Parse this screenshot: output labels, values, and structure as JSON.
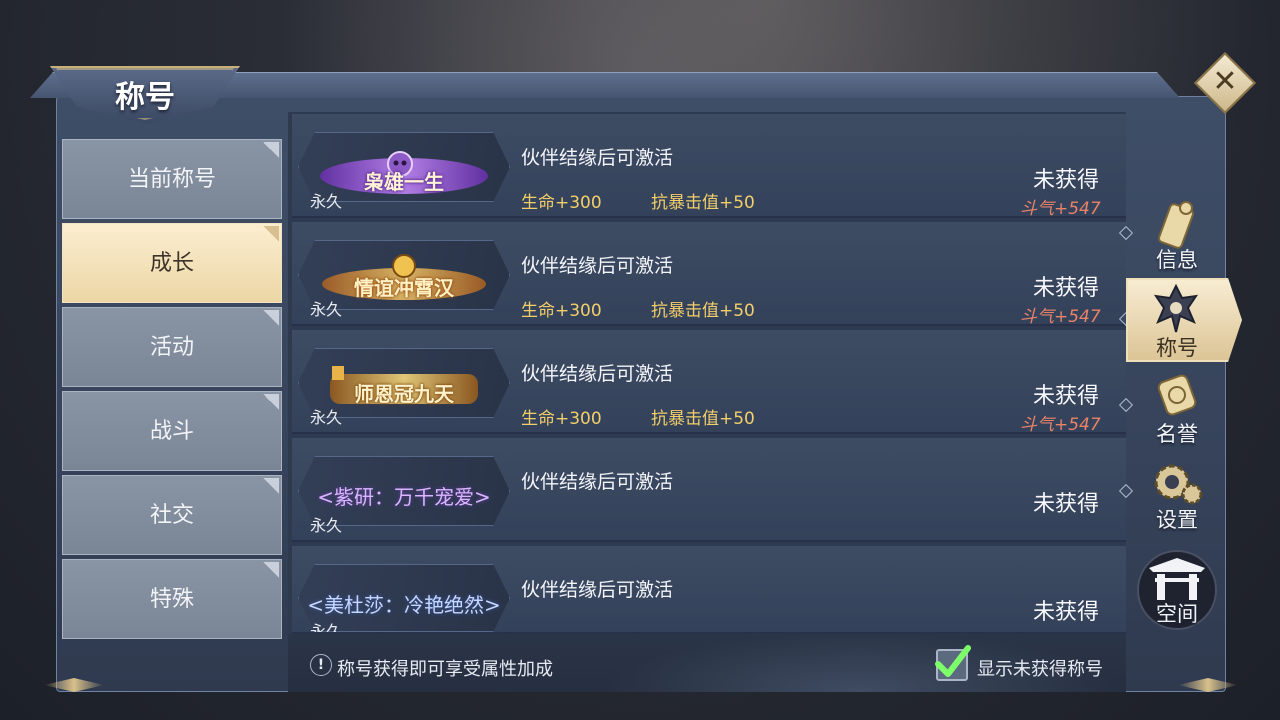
{
  "window": {
    "title": "称号",
    "close_icon": "close-x-icon"
  },
  "categories": [
    {
      "label": "当前称号",
      "active": false
    },
    {
      "label": "成长",
      "active": true
    },
    {
      "label": "活动",
      "active": false
    },
    {
      "label": "战斗",
      "active": false
    },
    {
      "label": "社交",
      "active": false
    },
    {
      "label": "特殊",
      "active": false
    }
  ],
  "titles": [
    {
      "badge_type": "art-purple-skull",
      "badge_art_text": "枭雄一生",
      "duration": "永久",
      "requirement": "伙伴结缘后可激活",
      "attr1": "生命+300",
      "attr2": "抗暴击值+50",
      "status": "未获得",
      "power": "斗气+547"
    },
    {
      "badge_type": "art-gold-flame",
      "badge_art_text": "情谊冲霄汉",
      "duration": "永久",
      "requirement": "伙伴结缘后可激活",
      "attr1": "生命+300",
      "attr2": "抗暴击值+50",
      "status": "未获得",
      "power": "斗气+547"
    },
    {
      "badge_type": "art-gold-scroll",
      "badge_art_text": "师恩冠九天",
      "duration": "永久",
      "requirement": "伙伴结缘后可激活",
      "attr1": "生命+300",
      "attr2": "抗暴击值+50",
      "status": "未获得",
      "power": "斗气+547"
    },
    {
      "badge_type": "text-purple",
      "badge_text": "<紫研：万千宠爱>",
      "duration": "永久",
      "requirement": "伙伴结缘后可激活",
      "status": "未获得"
    },
    {
      "badge_type": "text-blue",
      "badge_text": "<美杜莎：冷艳绝然>",
      "duration": "永久",
      "requirement": "伙伴结缘后可激活",
      "status": "未获得"
    }
  ],
  "footer": {
    "info_icon": "!",
    "tip": "称号获得即可享受属性加成",
    "checkbox_label": "显示未获得称号",
    "checkbox_checked": true
  },
  "side_tabs": [
    {
      "label": "信息",
      "icon": "scroll-icon",
      "active": false
    },
    {
      "label": "称号",
      "icon": "crest-icon",
      "active": true
    },
    {
      "label": "名誉",
      "icon": "medal-icon",
      "active": false
    },
    {
      "label": "设置",
      "icon": "gear-icon",
      "active": false
    },
    {
      "label": "空间",
      "icon": "gate-icon",
      "active": false
    }
  ],
  "colors": {
    "accent_gold": "#f2cf6a",
    "power_red": "#e88468",
    "active_tab": "#f7ecd2",
    "panel_blue": "#3d4b63"
  }
}
